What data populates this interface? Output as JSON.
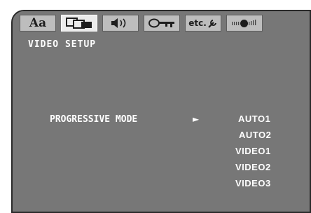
{
  "menu": {
    "tabs": [
      {
        "id": "language",
        "icon": "language-aa-icon",
        "label": "Aa",
        "active": false
      },
      {
        "id": "video",
        "icon": "video-screens-icon",
        "active": true
      },
      {
        "id": "audio",
        "icon": "audio-speaker-icon",
        "active": false
      },
      {
        "id": "parental",
        "icon": "key-lock-icon",
        "active": false
      },
      {
        "id": "etc",
        "icon": "etc-settings-icon",
        "label": "etc.",
        "active": false
      },
      {
        "id": "timer",
        "icon": "slider-timer-icon",
        "active": false
      }
    ],
    "title": "VIDEO SETUP",
    "setting": {
      "label": "PROGRESSIVE MODE",
      "pointer": "►",
      "options": [
        "AUTO1",
        "AUTO2",
        "VIDEO1",
        "VIDEO2",
        "VIDEO3"
      ],
      "selected_index": 0
    }
  },
  "colors": {
    "panel_background": "#777777",
    "text": "#ffffff",
    "active_tab": "#ececec",
    "inactive_tab": "#bdbdbd",
    "icon": "#2a2a2a"
  }
}
